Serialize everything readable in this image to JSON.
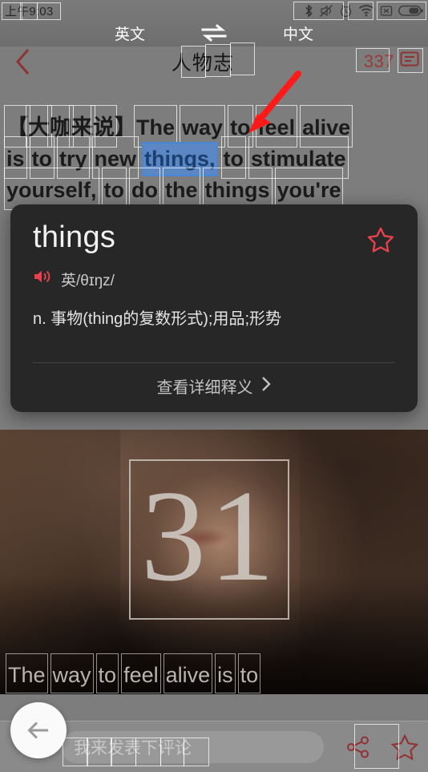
{
  "status_bar": {
    "time": "上午9:03",
    "icons": [
      "bluetooth-icon",
      "mute-icon",
      "alarm-icon",
      "wifi-icon",
      "no-sim-icon",
      "battery-icon"
    ]
  },
  "lang_switch": {
    "source": "英文",
    "swap": "⇌",
    "target": "中文"
  },
  "header": {
    "back": "‹",
    "title": "人物志",
    "comment_count": "337",
    "comment_icon": "comment-bubble-icon"
  },
  "article": {
    "lines": [
      [
        "【",
        "大",
        "咖",
        "来",
        "说",
        "】",
        "The",
        "way",
        "to",
        "feel",
        "alive"
      ],
      [
        "is",
        "to",
        "try",
        "new",
        "things,",
        "to",
        "stimulate"
      ],
      [
        "yourself,",
        "to",
        "do",
        "the",
        "things",
        "you're"
      ]
    ],
    "selected_word": "things,",
    "selected_line": 1,
    "selected_index": 4
  },
  "dictionary": {
    "word": "things",
    "star_icon": "star-outline-icon",
    "speaker_icon": "speaker-icon",
    "phonetic": "英/θɪŋz/",
    "definition": "n. 事物(thing的复数形式);用品;形势",
    "more_label": "查看详细释义",
    "more_chevron": "›"
  },
  "hero": {
    "number": "31",
    "caption": [
      "The",
      "way",
      "to",
      "feel",
      "alive",
      "is",
      "to"
    ]
  },
  "bottom_bar": {
    "comment_placeholder": "我来发表下评论",
    "share_icon": "share-icon",
    "favorite_icon": "star-outline-icon",
    "back_fab_icon": "arrow-left-icon"
  },
  "annotation": {
    "arrow_color": "#ff1a1a",
    "points_to": "things"
  },
  "colors": {
    "accent_red": "#8e3333",
    "selection_blue": "#5b87c4",
    "popup_bg": "#272727",
    "star_red": "#e8414e"
  }
}
